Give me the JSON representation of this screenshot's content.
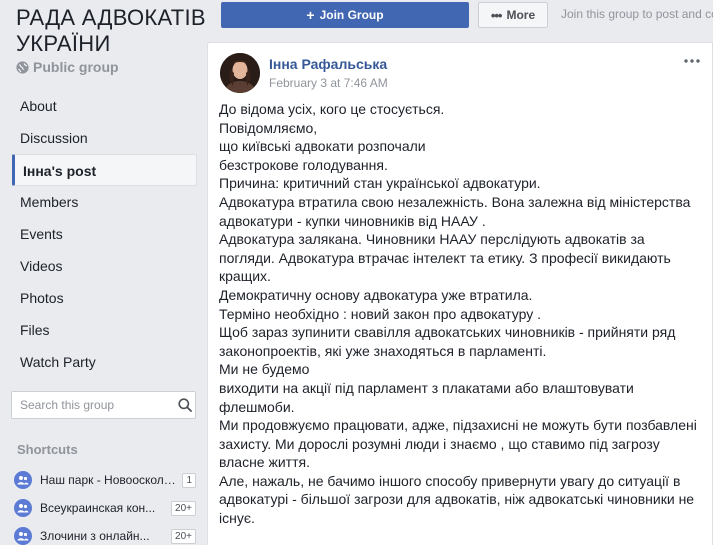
{
  "group": {
    "title": "РАДА АДВОКАТІВ УКРАЇНИ",
    "type": "Public group"
  },
  "nav": [
    {
      "label": "About"
    },
    {
      "label": "Discussion"
    },
    {
      "label": "Інна's post",
      "active": true
    },
    {
      "label": "Members"
    },
    {
      "label": "Events"
    },
    {
      "label": "Videos"
    },
    {
      "label": "Photos"
    },
    {
      "label": "Files"
    },
    {
      "label": "Watch Party"
    }
  ],
  "search": {
    "placeholder": "Search this group"
  },
  "shortcuts": {
    "title": "Shortcuts",
    "items": [
      {
        "label": "Наш парк - Новоосколь...",
        "badge": "1"
      },
      {
        "label": "Всеукраинская кон...",
        "badge": "20+"
      },
      {
        "label": "Злочини з онлайн...",
        "badge": "20+"
      }
    ]
  },
  "actions": {
    "join_label": "Join Group",
    "more_label": "More",
    "join_hint": "Join this group to post and comment."
  },
  "post": {
    "author": "Інна Рафальська",
    "date": "February 3 at 7:46 AM",
    "lines": [
      "До відома усіх, кого це стосується.",
      "Повідомляємо,",
      "що київські адвокати розпочали",
      "безстрокове голодування.",
      "Причина: критичний стан української адвокатури.",
      "Адвокатура втратила свою незалежність. Вона залежна від міністерства адвокатури - купки чиновників від НААУ .",
      "Адвокатура залякана. Чиновники НААУ перслідують адвокатів за погляди. Адвокатура втрачає інтелект та етику. З професії викидають кращих.",
      "Демократичну основу адвокатура уже втратила.",
      "Терміно необхідно : новий закон про адвокатуру .",
      "Щоб зараз зупинити свавілля адвокатських чиновників - прийняти ряд законопроектів, які уже знаходяться в парламенті.",
      "Ми не будемо",
      "виходити на акції під парламент з плакатами або влаштовувати флешмоби.",
      "Ми продовжуємо працювати, адже, підзахисні не можуть бути позбавлені захисту. Ми дорослі розумні люди і знаємо , що ставимо під загрозу власне життя.",
      "Але, нажаль, не бачимо іншого способу привернути увагу до ситуації в адвокатурі - більшої загрози для адвокатів, ніж адвокатські чиновники не існує."
    ]
  },
  "colors": {
    "brand": "#4267b2",
    "link": "#365899",
    "background": "#e9ebee",
    "muted": "#90949c"
  }
}
